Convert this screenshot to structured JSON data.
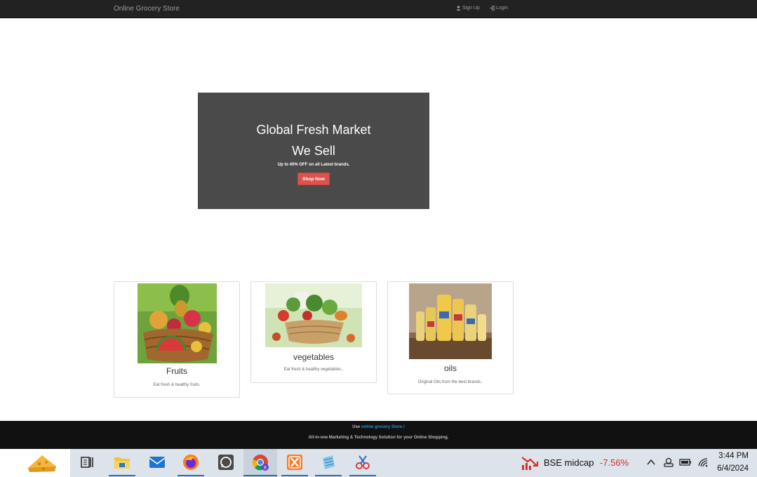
{
  "navbar": {
    "brand": "Online Grocery Store",
    "signup_label": "Sign Up",
    "login_label": "Login"
  },
  "hero": {
    "title": "Global Fresh Market",
    "subtitle": "We Sell",
    "offer": "Up to 40% OFF on all Latest brands.",
    "button_label": "Shop Now"
  },
  "cards": [
    {
      "title": "Fruits",
      "description": "Eat fresh & healthy fruits."
    },
    {
      "title": "vegetables",
      "description": "Eat fresh & healthy vegetables.."
    },
    {
      "title": "oils",
      "description": "Original Oils from the best brands.."
    }
  ],
  "footer": {
    "prefix": "Use",
    "link_text": "online grocery Store.!",
    "tagline": "All-in-one Marketing & Technology Solution for your Online Shopping."
  },
  "taskbar": {
    "stock_name": "BSE midcap",
    "stock_change": "-7.56%",
    "time": "3:44 PM",
    "date": "6/4/2024"
  },
  "colors": {
    "navbar_bg": "#222222",
    "hero_bg": "#4a4a4a",
    "button_red": "#d9534f",
    "footer_bg": "#111111",
    "link_blue": "#2a8fd6",
    "stock_negative": "#d32f2f"
  }
}
